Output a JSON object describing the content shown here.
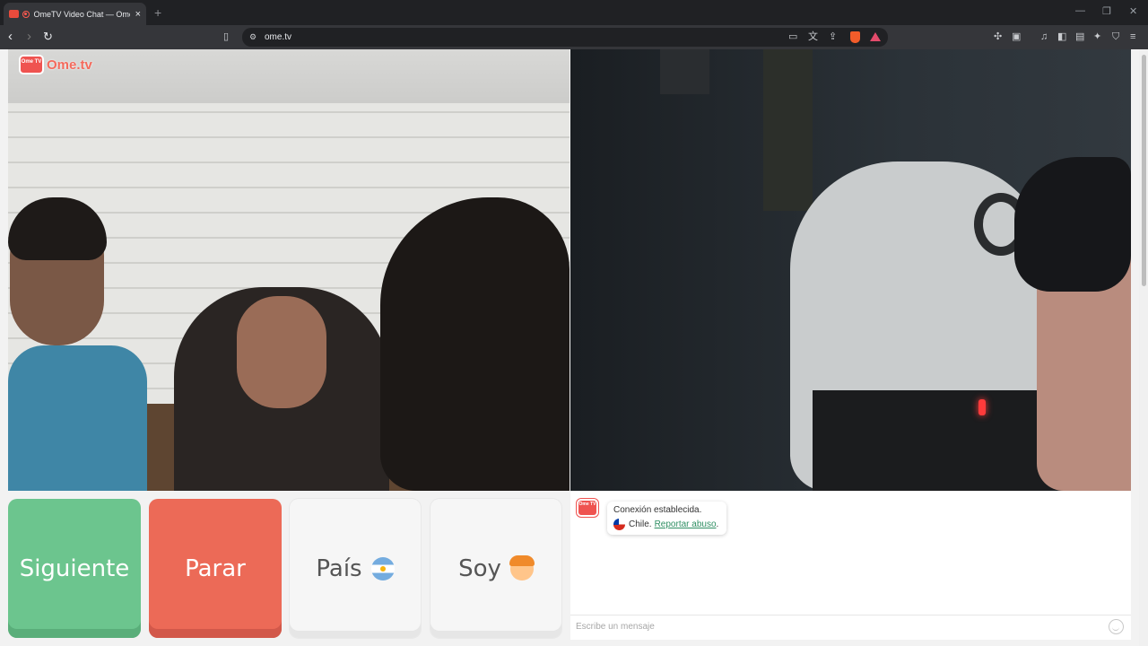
{
  "browser": {
    "tab_title": "OmeTV Video Chat — Omegle",
    "tab_close": "×",
    "new_tab": "+",
    "url": "ome.tv"
  },
  "logo": {
    "brand": "Ome.tv",
    "badge": "Ome TV"
  },
  "buttons": {
    "next": "Siguiente",
    "stop": "Parar",
    "country": "País",
    "gender": "Soy"
  },
  "chat": {
    "avatar_text": "Ome TV",
    "status": "Conexión establecida.",
    "country": "Chile.",
    "report": "Reportar abuso",
    "report_suffix": ".",
    "placeholder": "Escribe un mensaje"
  },
  "icons": {
    "country_flag": "argentina-flag",
    "gender_emoji": "boy-face",
    "stranger_flag": "chile-flag"
  },
  "colors": {
    "next": "#6cc58e",
    "stop": "#ec6a57",
    "brand": "#ef5350",
    "link": "#2f8f63"
  }
}
